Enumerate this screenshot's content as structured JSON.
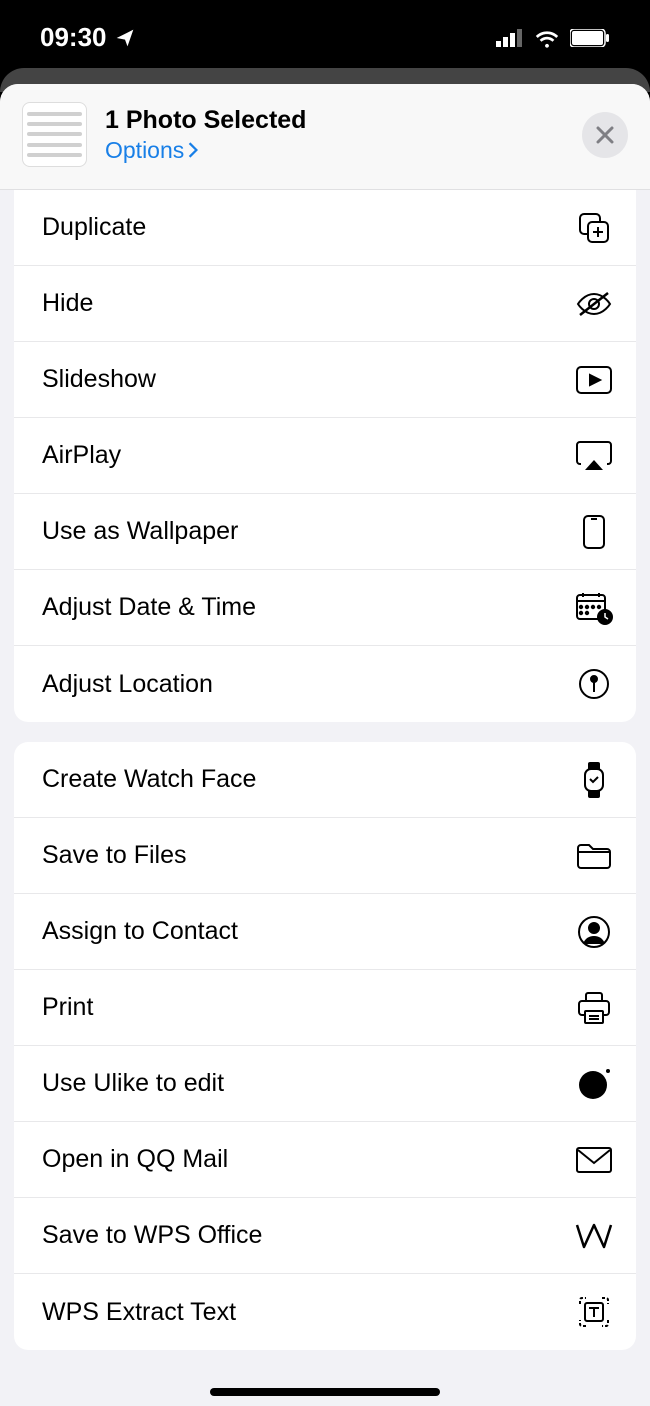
{
  "status": {
    "time": "09:30"
  },
  "header": {
    "title": "1 Photo Selected",
    "options": "Options"
  },
  "group1": [
    {
      "label": "Duplicate",
      "icon": "duplicate-icon"
    },
    {
      "label": "Hide",
      "icon": "hide-icon"
    },
    {
      "label": "Slideshow",
      "icon": "slideshow-icon"
    },
    {
      "label": "AirPlay",
      "icon": "airplay-icon"
    },
    {
      "label": "Use as Wallpaper",
      "icon": "wallpaper-icon"
    },
    {
      "label": "Adjust Date & Time",
      "icon": "datetime-icon"
    },
    {
      "label": "Adjust Location",
      "icon": "location-icon"
    }
  ],
  "group2": [
    {
      "label": "Create Watch Face",
      "icon": "watch-icon"
    },
    {
      "label": "Save to Files",
      "icon": "folder-icon"
    },
    {
      "label": "Assign to Contact",
      "icon": "contact-icon"
    },
    {
      "label": "Print",
      "icon": "print-icon"
    },
    {
      "label": "Use Ulike to edit",
      "icon": "ulike-icon"
    },
    {
      "label": "Open in QQ Mail",
      "icon": "mail-icon"
    },
    {
      "label": "Save to WPS Office",
      "icon": "wps-icon"
    },
    {
      "label": "WPS Extract Text",
      "icon": "extract-icon"
    }
  ]
}
